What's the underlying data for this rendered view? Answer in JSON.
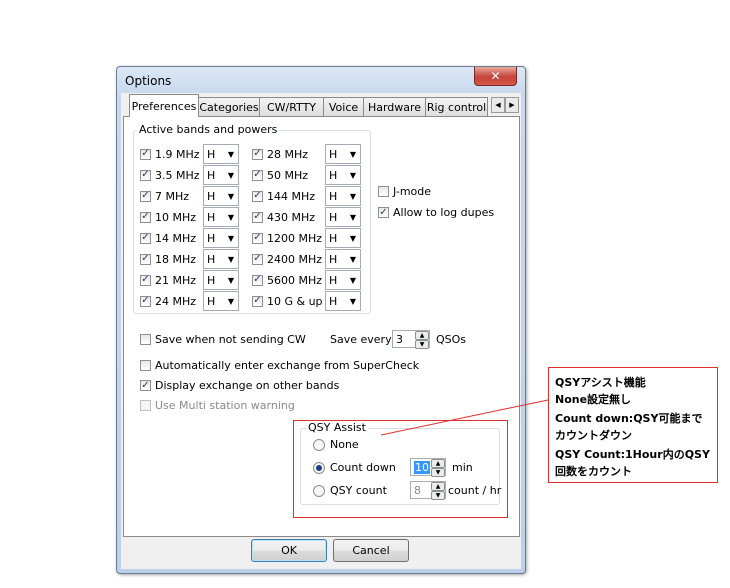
{
  "window": {
    "title": "Options",
    "close_glyph": "✕"
  },
  "tabs": [
    {
      "label": "Preferences"
    },
    {
      "label": "Categories"
    },
    {
      "label": "CW/RTTY"
    },
    {
      "label": "Voice"
    },
    {
      "label": "Hardware"
    },
    {
      "label": "Rig control"
    }
  ],
  "tab_scroll": {
    "left": "◀",
    "right": "▶"
  },
  "bands": {
    "group_label": "Active bands and powers",
    "left": [
      {
        "label": "1.9 MHz",
        "power": "H",
        "checked": true
      },
      {
        "label": "3.5 MHz",
        "power": "H",
        "checked": true
      },
      {
        "label": "7 MHz",
        "power": "H",
        "checked": true
      },
      {
        "label": "10 MHz",
        "power": "H",
        "checked": true
      },
      {
        "label": "14 MHz",
        "power": "H",
        "checked": true
      },
      {
        "label": "18 MHz",
        "power": "H",
        "checked": true
      },
      {
        "label": "21 MHz",
        "power": "H",
        "checked": true
      },
      {
        "label": "24 MHz",
        "power": "H",
        "checked": true
      }
    ],
    "right": [
      {
        "label": "28 MHz",
        "power": "H",
        "checked": true
      },
      {
        "label": "50 MHz",
        "power": "H",
        "checked": true
      },
      {
        "label": "144 MHz",
        "power": "H",
        "checked": true
      },
      {
        "label": "430 MHz",
        "power": "H",
        "checked": true
      },
      {
        "label": "1200 MHz",
        "power": "H",
        "checked": true
      },
      {
        "label": "2400 MHz",
        "power": "H",
        "checked": true
      },
      {
        "label": "5600 MHz",
        "power": "H",
        "checked": true
      },
      {
        "label": "10 G & up",
        "power": "H",
        "checked": true
      }
    ]
  },
  "jmode": {
    "label": "J-mode",
    "checked": false
  },
  "allow_dupes": {
    "label": "Allow to log dupes",
    "checked": true
  },
  "save_when_not_sending": {
    "label": "Save when not sending CW",
    "checked": false
  },
  "save_every": {
    "label": "Save every",
    "value": "3",
    "unit": "QSOs"
  },
  "auto_exchange": {
    "label": "Automatically enter exchange from SuperCheck",
    "checked": false
  },
  "display_exchange": {
    "label": "Display exchange on other bands",
    "checked": true
  },
  "multi_station": {
    "label": "Use Multi station warning",
    "checked": false,
    "disabled": true
  },
  "qsy_assist": {
    "group_label": "QSY Assist",
    "none_label": "None",
    "countdown_label": "Count down",
    "countdown_value": "10",
    "countdown_unit": "min",
    "qsycount_label": "QSY count",
    "qsycount_value": "8",
    "qsycount_unit": "count / hr",
    "selected": "countdown"
  },
  "buttons": {
    "ok": "OK",
    "cancel": "Cancel"
  },
  "annotation": {
    "lines": [
      "QSYアシスト機能",
      "None設定無し",
      "Count down:QSY可能まで",
      "カウントダウン",
      "QSY Count:1Hour内のQSY",
      "回数をカウント"
    ],
    "color": "#e0302b"
  },
  "glyphs": {
    "check": "✓",
    "dropdown": "▼",
    "up": "▲",
    "down": "▼"
  }
}
